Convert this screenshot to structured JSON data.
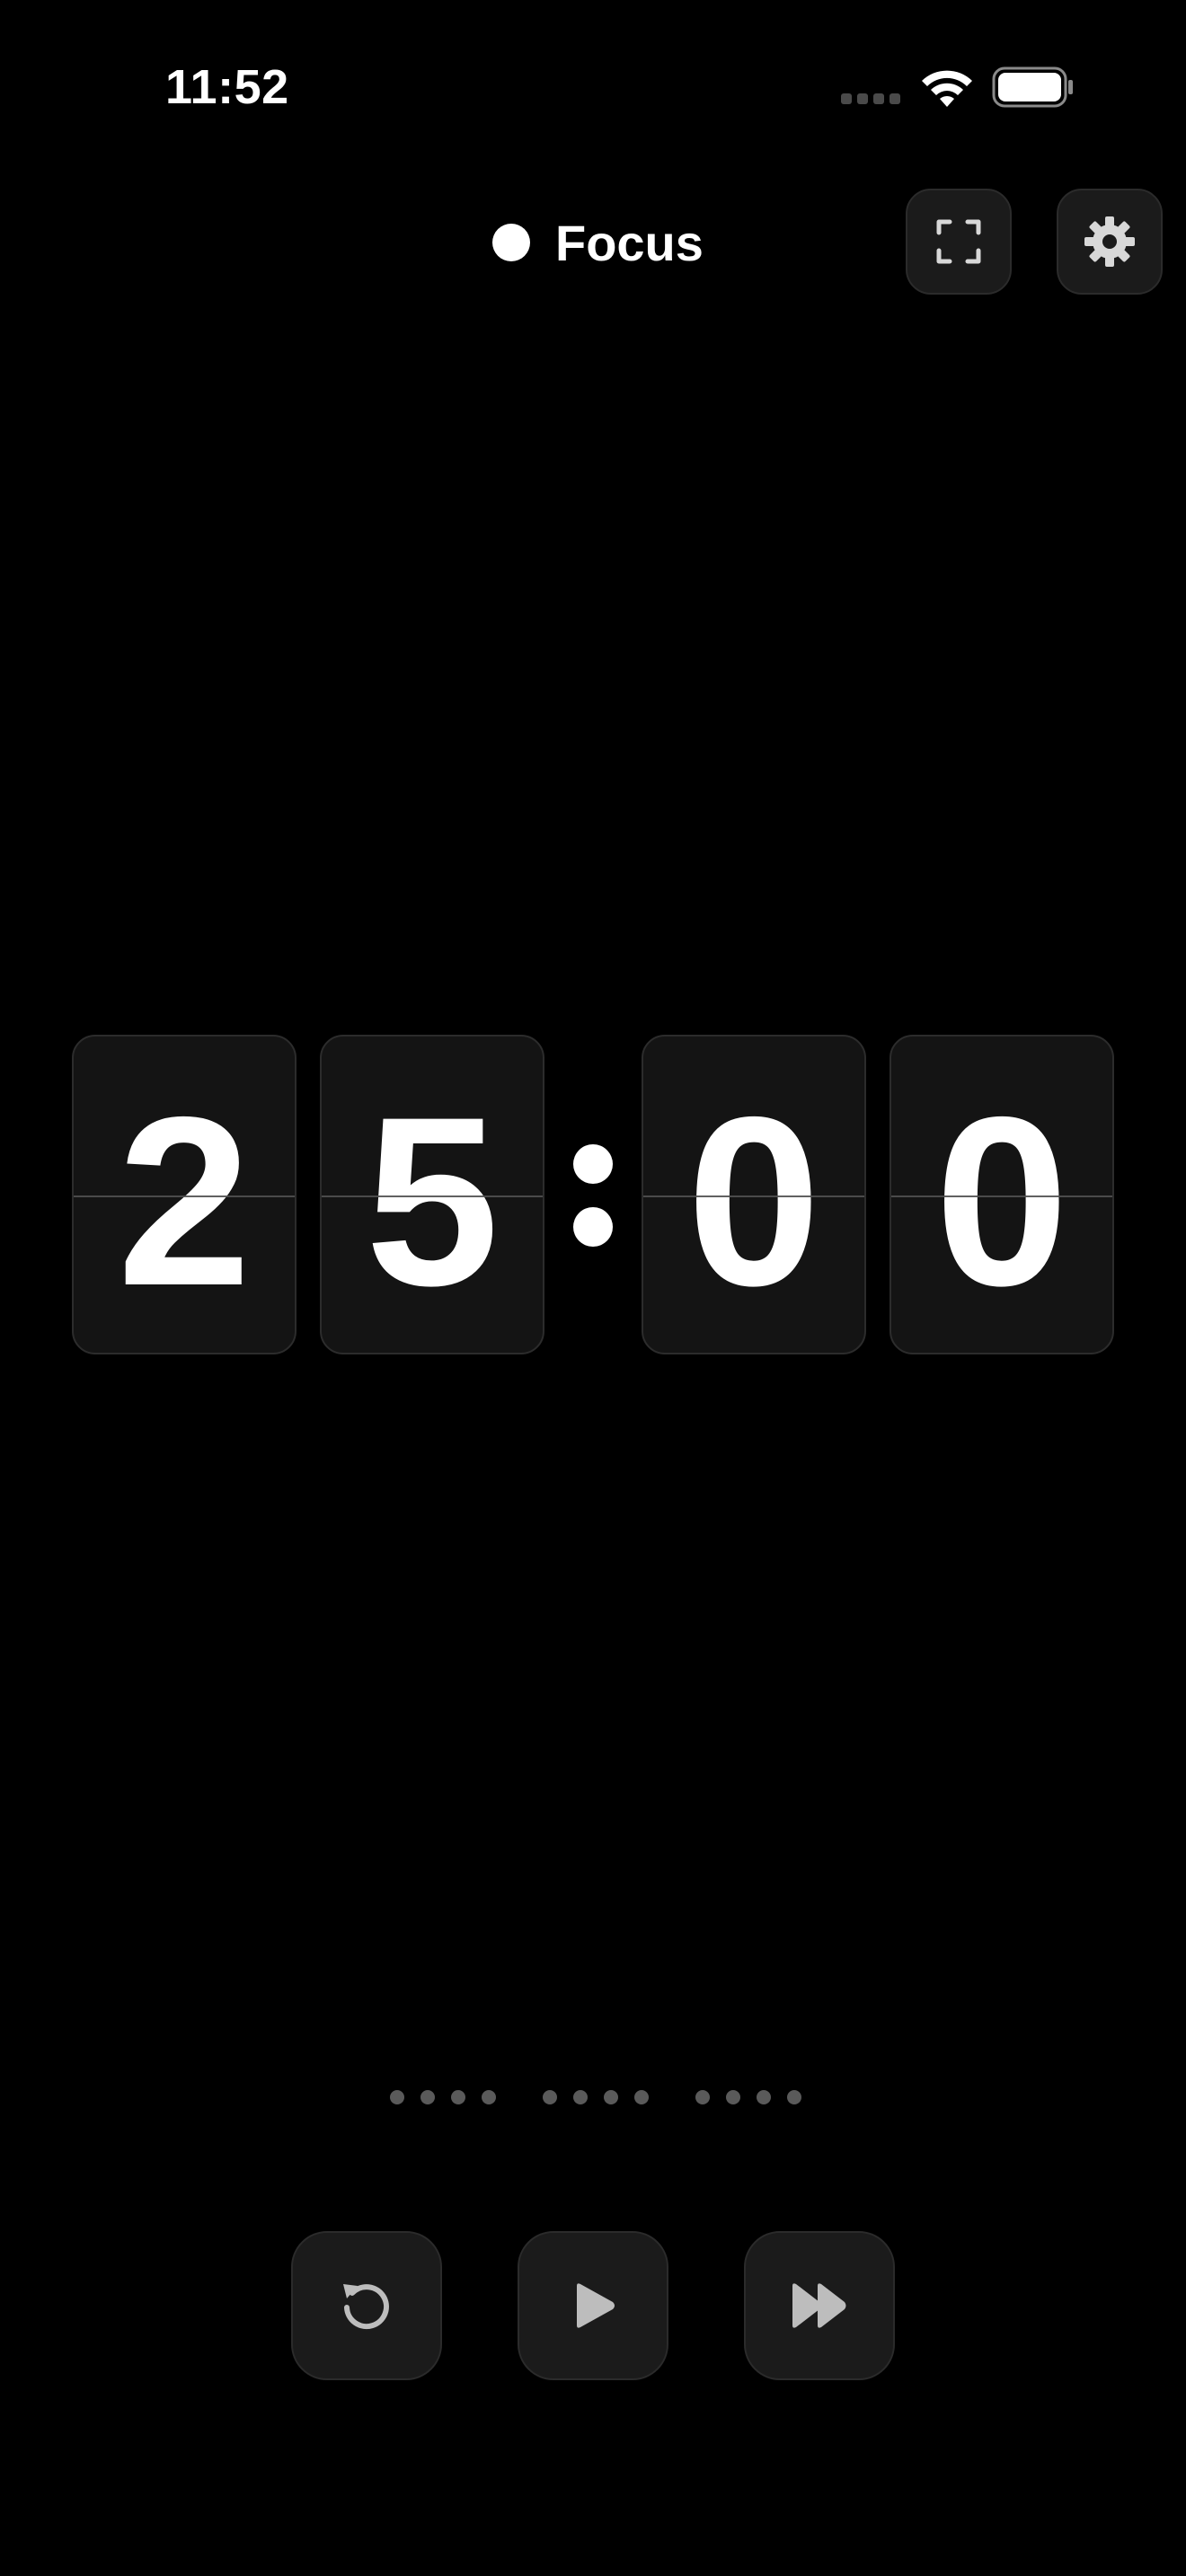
{
  "status_bar": {
    "time": "11:52",
    "icons": [
      "signal-dots-icon",
      "wifi-icon",
      "battery-icon"
    ]
  },
  "header": {
    "mode_label": "Focus",
    "fullscreen_icon": "fullscreen-icon",
    "settings_icon": "gear-icon"
  },
  "timer": {
    "digits": [
      "2",
      "5",
      "0",
      "0"
    ],
    "separator": ":"
  },
  "sessions": {
    "groups": 3,
    "dots_per_group": 4
  },
  "controls": {
    "icons": [
      "reset-icon",
      "play-icon",
      "skip-forward-icon"
    ]
  },
  "colors": {
    "background": "#000000",
    "card": "#141414",
    "button": "#1b1b1b",
    "text": "#ffffff",
    "icon": "#bdbdbd",
    "inactive_dot": "#5a5a5a"
  }
}
